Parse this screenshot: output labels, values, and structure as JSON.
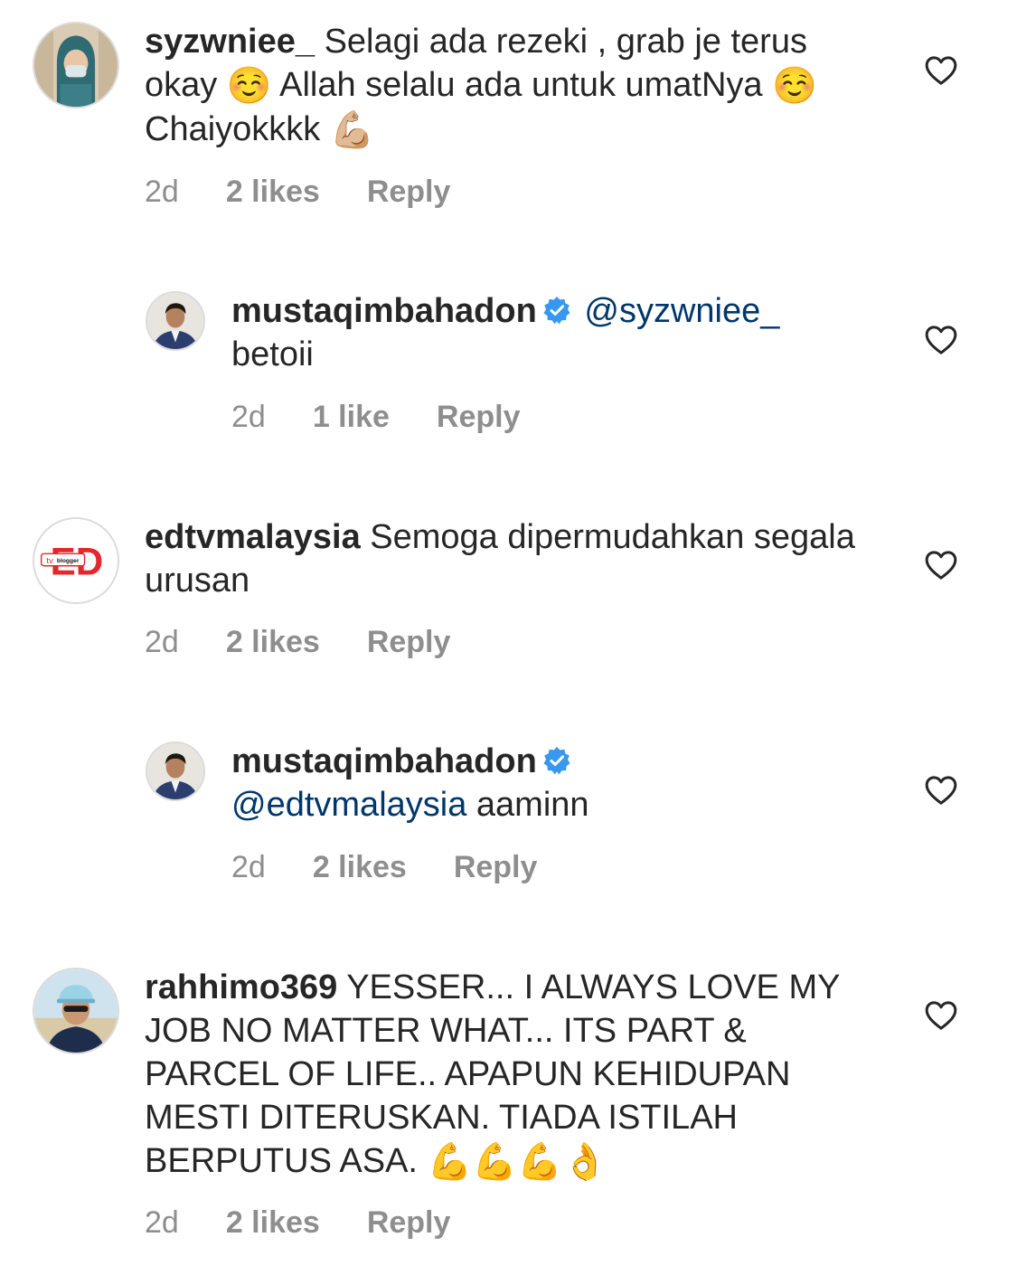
{
  "comments": [
    {
      "username": "syzwniee_",
      "text": "Selagi ada rezeki , grab je terus okay",
      "emoji1": "☺️",
      "text2": "Allah selalu ada untuk umatNya",
      "emoji2": "☺️",
      "text3": "Chaiyokkkk",
      "emoji3": "💪🏼",
      "time": "2d",
      "likes": "2 likes",
      "reply": "Reply",
      "avatar": "profile-photo-hijab-mask"
    },
    {
      "username": "mustaqimbahadon",
      "verified": true,
      "mention": "@syzwniee_",
      "text": "betoii",
      "time": "2d",
      "likes": "1 like",
      "reply": "Reply",
      "avatar": "profile-photo-man-suit"
    },
    {
      "username": "edtvmalaysia",
      "text": "Semoga dipermudahkan segala urusan",
      "time": "2d",
      "likes": "2 likes",
      "reply": "Reply",
      "avatar": "ed-tv-blogger-logo",
      "logo": {
        "letters": "ED",
        "badge": "tv",
        "tag": "blogger"
      }
    },
    {
      "username": "mustaqimbahadon",
      "verified": true,
      "mention": "@edtvmalaysia",
      "text": "aaminn",
      "time": "2d",
      "likes": "2 likes",
      "reply": "Reply",
      "avatar": "profile-photo-man-suit"
    },
    {
      "username": "rahhimo369",
      "text": "YESSER... I ALWAYS LOVE MY JOB NO MATTER WHAT... ITS PART & PARCEL OF LIFE.. APAPUN KEHIDUPAN MESTI DITERUSKAN. TIADA ISTILAH BERPUTUS ASA.",
      "emoji": "💪💪💪👌",
      "time": "2d",
      "likes": "2 likes",
      "reply": "Reply",
      "avatar": "profile-photo-man-cap-beach"
    }
  ],
  "colors": {
    "text": "#262626",
    "meta": "#8e8e8e",
    "mention": "#00376b",
    "verified": "#3897f0",
    "ed_red": "#e0282e"
  },
  "icons": {
    "like": "heart-outline-icon",
    "verified": "verified-badge-icon"
  }
}
